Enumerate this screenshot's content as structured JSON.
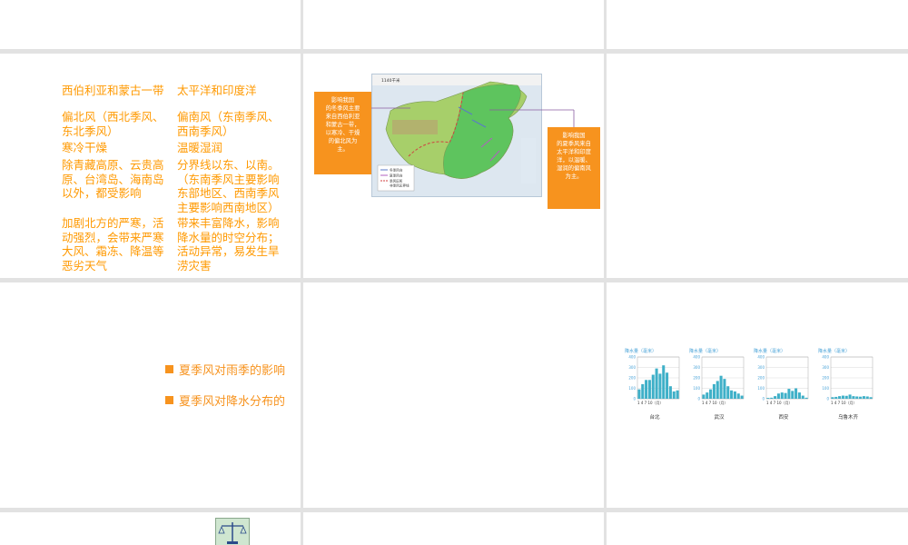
{
  "comparison": {
    "winter_source": "西伯利亚和蒙古一带",
    "summer_source": "太平洋和印度洋",
    "winter_direction": "偏北风（西北季风、\n东北季风）",
    "summer_direction": "偏南风（东南季风、\n西南季风）",
    "winter_nature": "寒冷干燥",
    "summer_nature": "温暖湿润",
    "winter_range": "除青藏高原、云贵高\n原、台湾岛、海南岛\n以外，都受影响",
    "summer_range": "分界线以东、以南。\n（东南季风主要影响\n东部地区、西南季风\n主要影响西南地区）",
    "winter_effect": "加剧北方的严寒，活\n动强烈，会带来严寒\n大风、霜冻、降温等\n恶劣天气",
    "summer_effect": "带来丰富降水，影响\n降水量的时空分布；\n活动异常，易发生旱\n涝灾害"
  },
  "monsoon_map": {
    "left_callout": "影响我国\n的冬季风主要\n来自西伯利亚\n和蒙古一带，\n以寒冷、干燥\n的偏北风为\n主。",
    "right_callout": "影响我国\n的夏季风来自\n太平洋和印度\n洋，以温暖、\n湿润的偏南风\n为主。",
    "legend": [
      "冬季风向",
      "夏季风向",
      "季风区和",
      "非季风区界线"
    ],
    "scale_text": "1140千米",
    "colors": {
      "monsoon_region": "#5ec45e",
      "non_monsoon_region": "#a7cf6a",
      "callout": "#f7931e"
    }
  },
  "bullets": {
    "item1": "夏季风对雨季的影响",
    "item2": "夏季风对降水分布的"
  },
  "precip": {
    "ylabel": "降水量（毫米）",
    "xticks": "1  4  7  10（月）",
    "yticks": [
      "400",
      "300",
      "200",
      "100",
      "0"
    ]
  },
  "chart_data": {
    "type": "bar",
    "categories": [
      "1",
      "2",
      "3",
      "4",
      "5",
      "6",
      "7",
      "8",
      "9",
      "10",
      "11",
      "12"
    ],
    "ylim": [
      0,
      400
    ],
    "charts": [
      {
        "city": "台北",
        "values": [
          90,
          140,
          180,
          180,
          230,
          290,
          240,
          320,
          250,
          120,
          70,
          80
        ]
      },
      {
        "city": "武汉",
        "values": [
          40,
          60,
          90,
          140,
          170,
          220,
          190,
          120,
          80,
          70,
          50,
          30
        ]
      },
      {
        "city": "西安",
        "values": [
          8,
          10,
          25,
          50,
          60,
          55,
          95,
          75,
          100,
          60,
          30,
          10
        ]
      },
      {
        "city": "乌鲁木齐",
        "values": [
          15,
          18,
          25,
          30,
          28,
          40,
          25,
          22,
          20,
          25,
          22,
          15
        ]
      }
    ]
  }
}
